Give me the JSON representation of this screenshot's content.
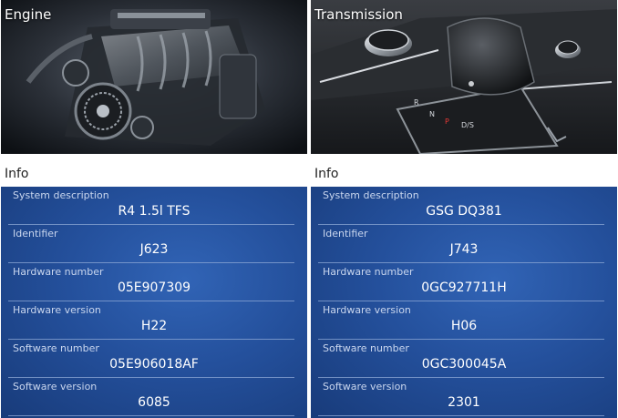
{
  "panels": [
    {
      "title": "Engine",
      "info_title": "Info",
      "rows": [
        {
          "label": "System description",
          "value": "R4 1.5l TFS"
        },
        {
          "label": "Identifier",
          "value": "J623"
        },
        {
          "label": "Hardware number",
          "value": "05E907309"
        },
        {
          "label": "Hardware version",
          "value": "H22"
        },
        {
          "label": "Software number",
          "value": "05E906018AF"
        },
        {
          "label": "Software version",
          "value": "6085"
        }
      ]
    },
    {
      "title": "Transmission",
      "info_title": "Info",
      "rows": [
        {
          "label": "System description",
          "value": "GSG DQ381"
        },
        {
          "label": "Identifier",
          "value": "J743"
        },
        {
          "label": "Hardware number",
          "value": "0GC927711H"
        },
        {
          "label": "Hardware version",
          "value": "H06"
        },
        {
          "label": "Software number",
          "value": "0GC300045A"
        },
        {
          "label": "Software version",
          "value": "2301"
        }
      ]
    }
  ],
  "colors": {
    "info_gradient_center": "#3164b6",
    "info_gradient_edge": "#183b7a",
    "label_text": "#c9d6ee",
    "value_text": "#ffffff"
  }
}
